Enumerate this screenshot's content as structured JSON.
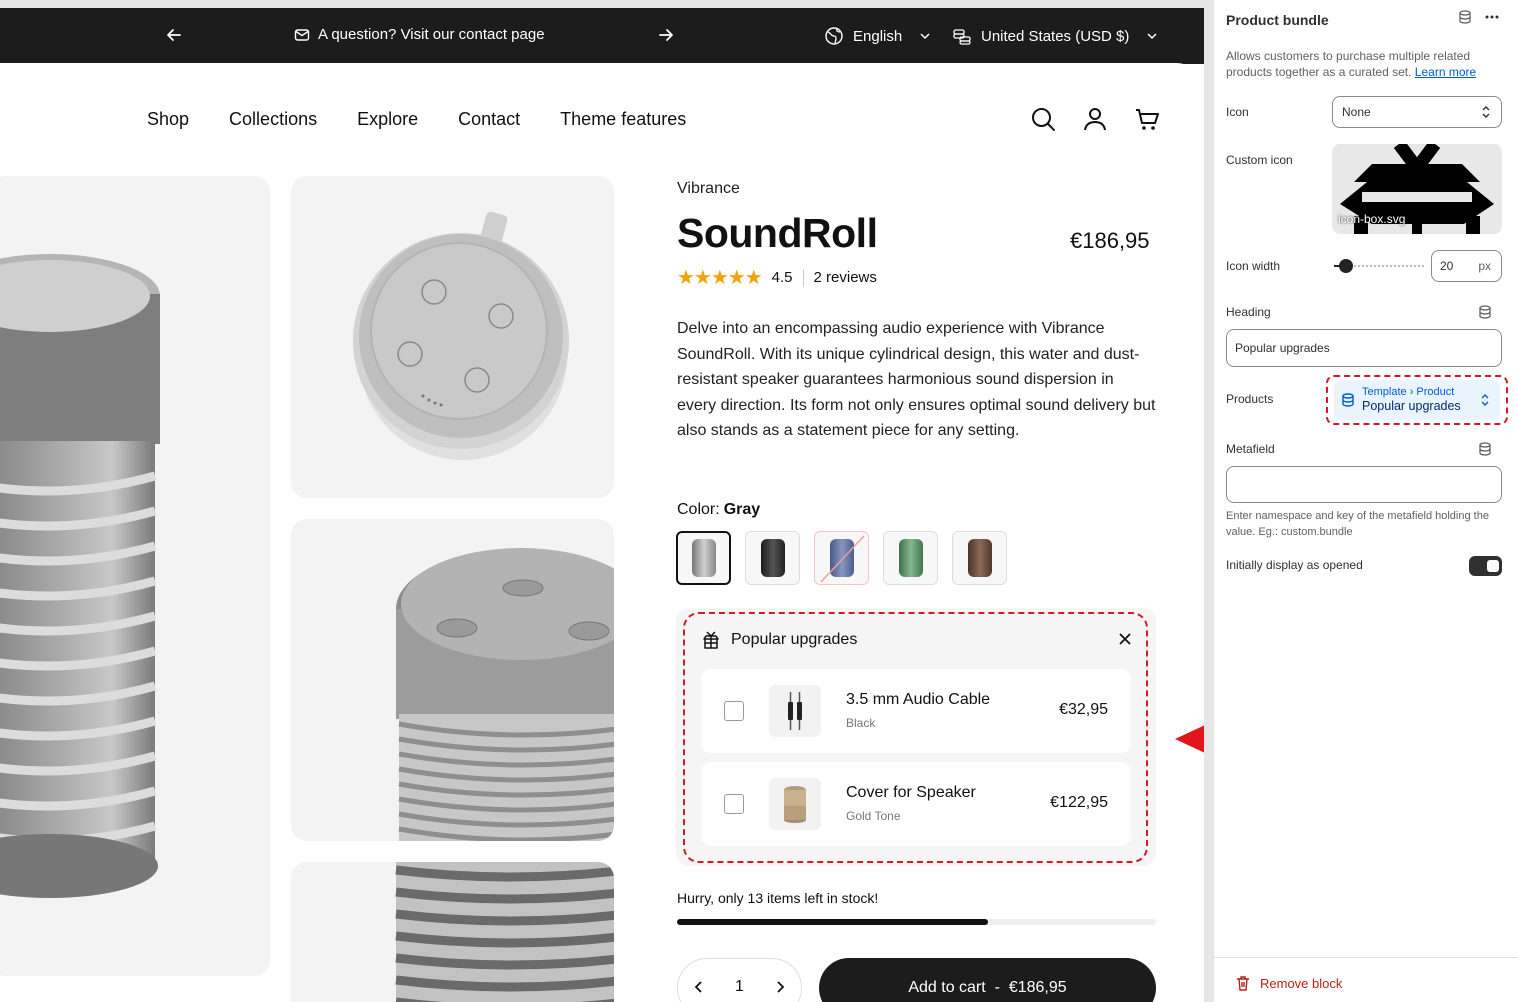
{
  "announcement": {
    "message": "A question? Visit our contact page",
    "language": "English",
    "currency": "United States (USD $)"
  },
  "nav": {
    "items": [
      "Shop",
      "Collections",
      "Explore",
      "Contact",
      "Theme features"
    ],
    "icons": [
      "search-icon",
      "account-icon",
      "cart-icon"
    ]
  },
  "product": {
    "vendor": "Vibrance",
    "title": "SoundRoll",
    "price": "€186,95",
    "rating": "4.5",
    "reviews": "2 reviews",
    "stars": "★★★★★",
    "description": "Delve into an encompassing audio experience with Vibrance SoundRoll. With its unique cylindrical design, this water and dust-resistant speaker guarantees harmonious sound dispersion in every direction. Its form not only ensures optimal sound delivery but also stands as a statement piece for any setting.",
    "color_label": "Color:",
    "color_value": "Gray",
    "swatch_colors": [
      "#9a9a9a",
      "#2b2b2b",
      "#5c6f9e",
      "#4f8a5b",
      "#5e4536"
    ]
  },
  "bundle": {
    "heading": "Popular upgrades",
    "items": [
      {
        "name": "3.5 mm Audio Cable",
        "variant": "Black",
        "price": "€32,95"
      },
      {
        "name": "Cover for Speaker",
        "variant": "Gold Tone",
        "price": "€122,95"
      }
    ]
  },
  "stock": {
    "text": "Hurry, only 13 items left in stock!",
    "fill_fraction": 0.65
  },
  "cart": {
    "quantity": "1",
    "add_label": "Add to cart  -  €186,95"
  },
  "panel": {
    "title": "Product bundle",
    "description": "Allows customers to purchase multiple related products together as a curated set.",
    "learn_more": "Learn more",
    "icon_label": "Icon",
    "icon_value": "None",
    "custom_icon_label": "Custom icon",
    "custom_icon_file": "icon-box.svg",
    "icon_width_label": "Icon width",
    "icon_width_value": "20",
    "icon_width_unit": "px",
    "heading_label": "Heading",
    "heading_value": "Popular upgrades",
    "products_label": "Products",
    "products_source": "Template › Product",
    "products_value": "Popular upgrades",
    "metafield_label": "Metafield",
    "metafield_value": "",
    "metafield_hint": "Enter namespace and key of the metafield holding the value. Eg.: custom.bundle",
    "initially_open_label": "Initially display as opened",
    "initially_open": true,
    "remove_label": "Remove block"
  }
}
